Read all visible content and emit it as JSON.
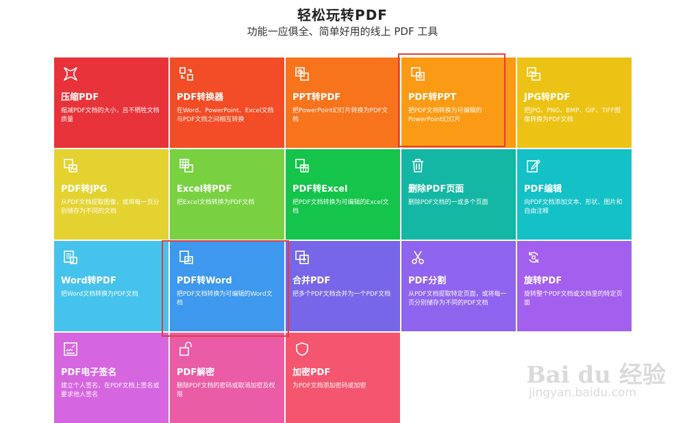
{
  "header": {
    "title": "轻松玩转PDF",
    "subtitle": "功能一应俱全、简单好用的线上 PDF 工具"
  },
  "tools": [
    {
      "name": "压缩PDF",
      "desc": "缩减PDF文档的大小，且不牺牲文档质量",
      "color": "#e8333b",
      "icon": "compress-icon"
    },
    {
      "name": "PDF转换器",
      "desc": "在Word、PowerPoint、Excel文档与PDF文档之间相互转换",
      "color": "#f24d26",
      "icon": "convert-icon"
    },
    {
      "name": "PPT转PDF",
      "desc": "把PowerPoint幻灯片转换为PDF文档",
      "color": "#f7731c",
      "icon": "ppt-icon"
    },
    {
      "name": "PDF转PPT",
      "desc": "把PDF文档转换为可编辑的PowerPoint幻灯片",
      "color": "#fb9a14",
      "icon": "pdf-to-ppt-icon"
    },
    {
      "name": "JPG转PDF",
      "desc": "把JPG、PNG、BMP、GIF、TIFF图像转换为PDF文档",
      "color": "#ecc314",
      "icon": "image-icon"
    },
    {
      "name": "PDF转JPG",
      "desc": "从PDF文档提取图像，或将每一页分别储存为不同的文档",
      "color": "#e4d230",
      "icon": "pdf-to-image-icon"
    },
    {
      "name": "Excel转PDF",
      "desc": "把Excel文档转换为PDF文档",
      "color": "#79d041",
      "icon": "excel-icon"
    },
    {
      "name": "PDF转Excel",
      "desc": "把PDF文档转换为可编辑的Excel文档",
      "color": "#14c44b",
      "icon": "pdf-to-excel-icon"
    },
    {
      "name": "删除PDF页面",
      "desc": "删除PDF文档的一或多个页面",
      "color": "#14b7a3",
      "icon": "trash-icon"
    },
    {
      "name": "PDF编辑",
      "desc": "向PDF文档添加文本、形状、图片和自由注释",
      "color": "#14c1c6",
      "icon": "edit-icon"
    },
    {
      "name": "Word转PDF",
      "desc": "把Word文档转换为PDF文档",
      "color": "#46c3ec",
      "icon": "word-icon"
    },
    {
      "name": "PDF转Word",
      "desc": "把PDF文档转换为可编辑的Word文档",
      "color": "#3d98ee",
      "icon": "pdf-to-word-icon"
    },
    {
      "name": "合并PDF",
      "desc": "把多个PDF文档合并为一个PDF文档",
      "color": "#7767e8",
      "icon": "merge-icon"
    },
    {
      "name": "PDF分割",
      "desc": "从PDF文档提取特定页面，或将每一页分别储存为不同的PDF文档",
      "color": "#8f64ee",
      "icon": "scissors-icon"
    },
    {
      "name": "旋转PDF",
      "desc": "旋转整个PDF文档或文档里的特定页面",
      "color": "#a35fee",
      "icon": "rotate-icon"
    },
    {
      "name": "PDF电子签名",
      "desc": "建立个人签名，在PDF文档上签名或要求他人签名",
      "color": "#d566e0",
      "icon": "signature-icon"
    },
    {
      "name": "PDF解密",
      "desc": "删除PDF文档的密码或取消加密及权限",
      "color": "#ea5ca5",
      "icon": "unlock-icon"
    },
    {
      "name": "加密PDF",
      "desc": "为PDF文档添加密码或加密",
      "color": "#f5566f",
      "icon": "shield-icon"
    }
  ],
  "highlight_color": "#e53b3b",
  "watermark": {
    "logo": "Bai du 经验",
    "url": "jingyan.baidu.com"
  }
}
